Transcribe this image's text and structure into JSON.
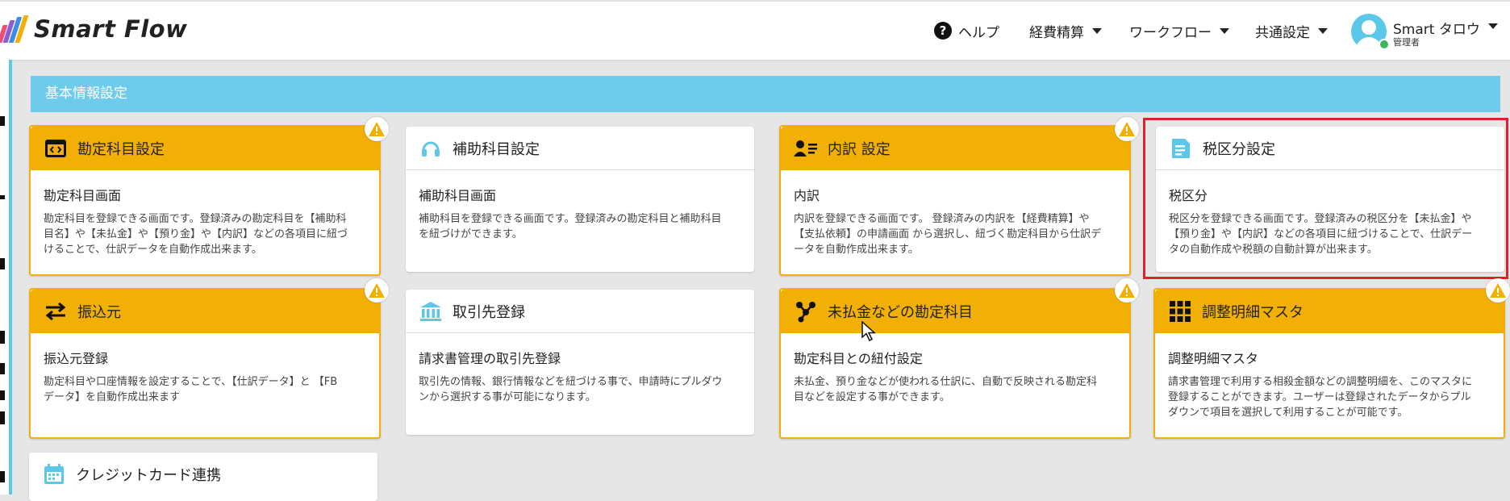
{
  "app": {
    "logo_text": "Smart Flow",
    "logo_colors": [
      "#e94e77",
      "#8e5bd6",
      "#3a8ee6",
      "#f2b006"
    ]
  },
  "nav": {
    "help_label": "ヘルプ",
    "expense_label": "経費精算",
    "workflow_label": "ワークフロー",
    "common_label": "共通設定"
  },
  "user": {
    "name": "Smart タロウ",
    "role": "管理者"
  },
  "section": {
    "title": "基本情報設定"
  },
  "cards": [
    {
      "title": "勘定科目設定",
      "subtitle": "勘定科目画面",
      "desc": [
        "勘定科目を登録できる画面です。登録済みの勘定科目を【補助科",
        "目名】や【未払金】や【預り金】や【内訳】などの各項目に紐づ",
        "けることで、仕訳データを自動作成出来ます。"
      ]
    },
    {
      "title": "補助科目設定",
      "subtitle": "補助科目画面",
      "desc": [
        "補助科目を登録できる画面です。登録済みの勘定科目と補助科目",
        "を紐づけができます。"
      ]
    },
    {
      "title": "内訳 設定",
      "subtitle": "内訳",
      "desc": [
        "内訳を登録できる画面です。 登録済みの内訳を【経費精算】や",
        "【支払依頼】の申請画面 から選択し、紐づく勘定科目から仕訳デ",
        "ータを自動作成出来ます。"
      ]
    },
    {
      "title": "税区分設定",
      "subtitle": "税区分",
      "desc": [
        "税区分を登録できる画面です。登録済みの税区分を【未払金】や",
        "【預り金】や【内訳】などの各項目に紐づけることで、仕訳デー",
        "タの自動作成や税額の自動計算が出来ます。"
      ]
    },
    {
      "title": "振込元",
      "subtitle": "振込元登録",
      "desc": [
        "勘定科目や口座情報を設定することで、【仕訳データ】と 【FB",
        "データ】を自動作成出来ます"
      ]
    },
    {
      "title": "取引先登録",
      "subtitle": "請求書管理の取引先登録",
      "desc": [
        "取引先の情報、銀行情報などを紐づける事で、申請時にプルダウ",
        "ンから選択する事が可能になります。"
      ]
    },
    {
      "title": "未払金などの勘定科目",
      "subtitle": "勘定科目との紐付設定",
      "desc": [
        "未払金、預り金などが使われる仕訳に、自動で反映される勘定科",
        "目などを設定する事ができます。"
      ]
    },
    {
      "title": "調整明細マスタ",
      "subtitle": "調整明細マスタ",
      "desc": [
        "請求書管理で利用する相殺金額などの調整明細を、このマスタに",
        "登録することができます。ユーザーは登録されたデータからプル",
        "ダウンで項目を選択して利用することが可能です。"
      ]
    },
    {
      "title": "クレジットカード連携"
    }
  ],
  "colors": {
    "accent_orange": "#f2b006",
    "banner_blue": "#6ecbeb",
    "highlight_red": "#e0202a"
  }
}
